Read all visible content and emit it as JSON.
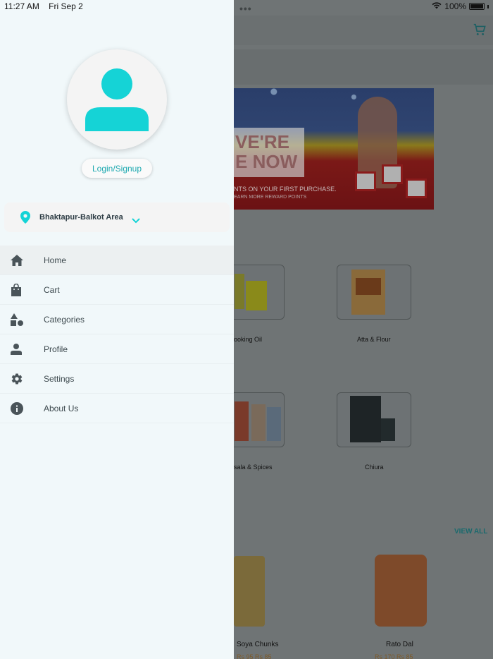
{
  "status": {
    "time": "11:27 AM",
    "date": "Fri Sep 2",
    "battery": "100%"
  },
  "drawer": {
    "login_label": "Login/Signup",
    "location": "Bhaktapur-Balkot Area",
    "menu": [
      {
        "label": "Home",
        "icon": "home-icon",
        "active": true
      },
      {
        "label": "Cart",
        "icon": "bag-icon",
        "active": false
      },
      {
        "label": "Categories",
        "icon": "shapes-icon",
        "active": false
      },
      {
        "label": "Profile",
        "icon": "person-icon",
        "active": false
      },
      {
        "label": "Settings",
        "icon": "gear-icon",
        "active": false
      },
      {
        "label": "About Us",
        "icon": "info-icon",
        "active": false
      }
    ],
    "accent": "#15d3d6"
  },
  "background": {
    "banner": {
      "headline_1": "VE'RE",
      "headline_2": "E NOW",
      "line_1": "NTS ON YOUR FIRST PURCHASE.",
      "line_2": "EARN MORE REWARD POINTS"
    },
    "categories": [
      {
        "label": "ooking Oil"
      },
      {
        "label": "Atta & Flour"
      },
      {
        "label": "sala & Spices"
      },
      {
        "label": "Chiura"
      }
    ],
    "view_all": "VIEW ALL",
    "products": [
      {
        "label": "Soya Chunks",
        "price": "Rs 95 Rs 85"
      },
      {
        "label": "Rato Dal",
        "price": "Rs 170 Rs 85"
      }
    ]
  }
}
